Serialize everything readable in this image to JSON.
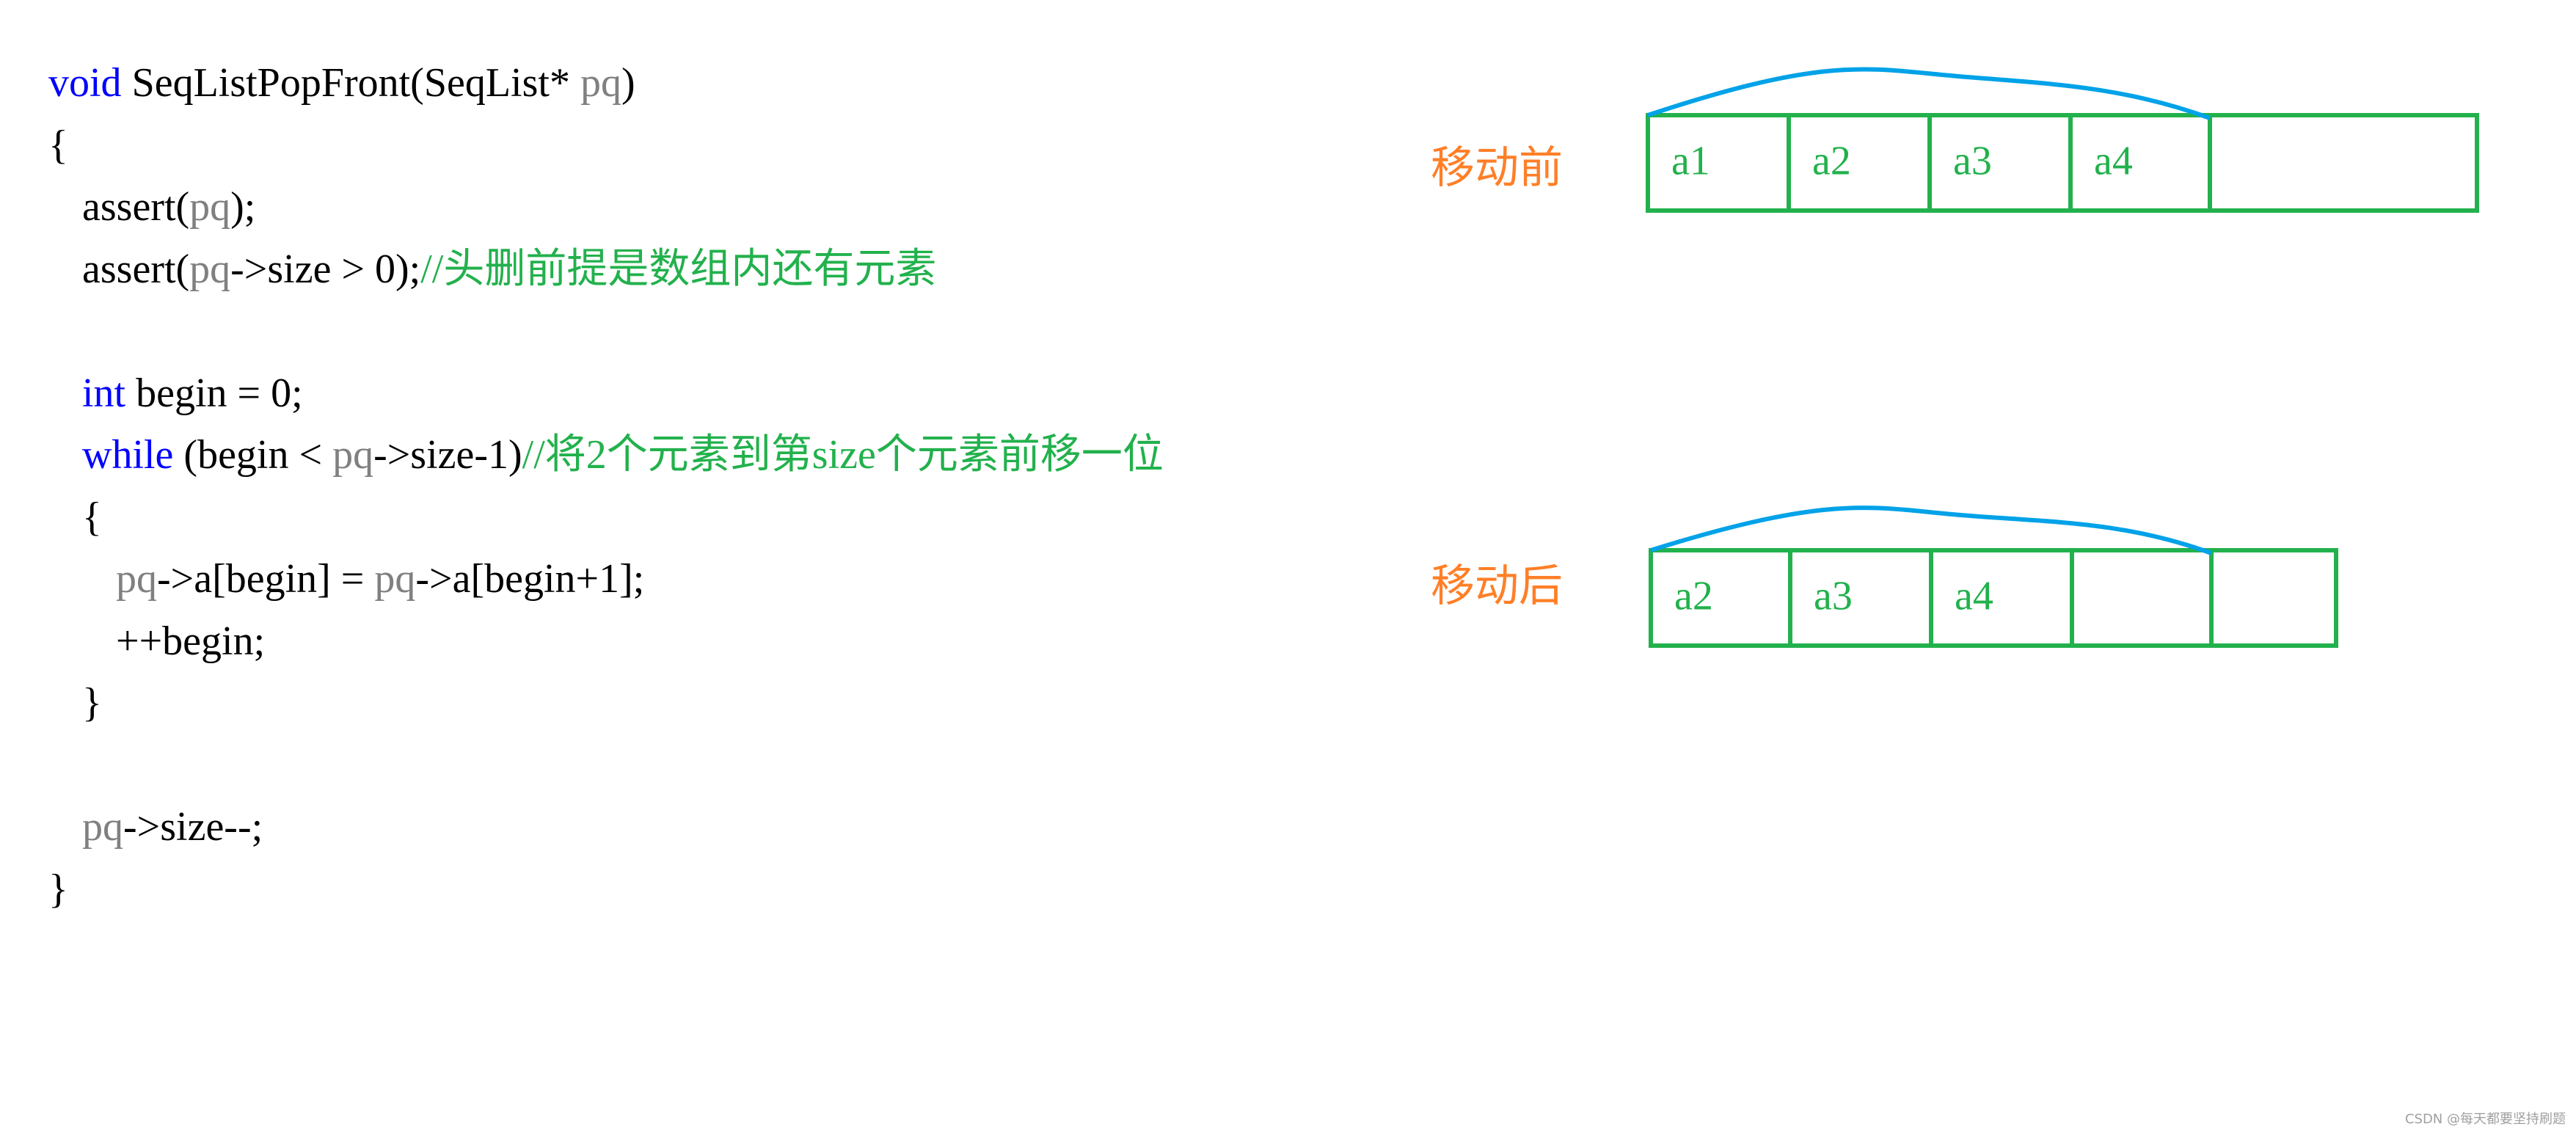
{
  "code": {
    "lines": [
      {
        "indent": 0,
        "parts": [
          {
            "t": "void",
            "c": "kw"
          },
          {
            "t": " SeqListPopFront(SeqList* ",
            "c": ""
          },
          {
            "t": "pq",
            "c": "var"
          },
          {
            "t": ")",
            "c": ""
          }
        ]
      },
      {
        "indent": 0,
        "parts": [
          {
            "t": "{",
            "c": ""
          }
        ]
      },
      {
        "indent": 1,
        "parts": [
          {
            "t": "assert(",
            "c": ""
          },
          {
            "t": "pq",
            "c": "var"
          },
          {
            "t": ");",
            "c": ""
          }
        ]
      },
      {
        "indent": 1,
        "parts": [
          {
            "t": "assert(",
            "c": ""
          },
          {
            "t": "pq",
            "c": "var"
          },
          {
            "t": "->size > 0);",
            "c": ""
          },
          {
            "t": "//头删前提是数组内还有元素",
            "c": "cm"
          }
        ]
      },
      {
        "indent": 0,
        "parts": []
      },
      {
        "indent": 1,
        "parts": [
          {
            "t": "int",
            "c": "kw"
          },
          {
            "t": " begin = 0;",
            "c": ""
          }
        ]
      },
      {
        "indent": 1,
        "parts": [
          {
            "t": "while",
            "c": "kw"
          },
          {
            "t": " (begin < ",
            "c": ""
          },
          {
            "t": "pq",
            "c": "var"
          },
          {
            "t": "->size-1)",
            "c": ""
          },
          {
            "t": "//将2个元素到第size个元素前移一位",
            "c": "cm"
          }
        ]
      },
      {
        "indent": 1,
        "parts": [
          {
            "t": "{",
            "c": ""
          }
        ]
      },
      {
        "indent": 2,
        "parts": [
          {
            "t": "pq",
            "c": "var"
          },
          {
            "t": "->a[begin] = ",
            "c": ""
          },
          {
            "t": "pq",
            "c": "var"
          },
          {
            "t": "->a[begin+1];",
            "c": ""
          }
        ]
      },
      {
        "indent": 2,
        "parts": [
          {
            "t": "++begin;",
            "c": ""
          }
        ]
      },
      {
        "indent": 1,
        "parts": [
          {
            "t": "}",
            "c": ""
          }
        ]
      },
      {
        "indent": 0,
        "parts": []
      },
      {
        "indent": 1,
        "parts": [
          {
            "t": "pq",
            "c": "var"
          },
          {
            "t": "->size--;",
            "c": ""
          }
        ]
      },
      {
        "indent": 0,
        "parts": [
          {
            "t": "}",
            "c": ""
          }
        ]
      }
    ]
  },
  "diagrams": {
    "before": {
      "label": "移动前",
      "cells": [
        "a1",
        "a2",
        "a3",
        "a4",
        ""
      ],
      "arc_spans_cells": 4
    },
    "after": {
      "label": "移动后",
      "cells": [
        "a2",
        "a3",
        "a4",
        "",
        ""
      ],
      "arc_spans_cells": 4
    }
  },
  "colors": {
    "keyword": "#0000ff",
    "variable": "#808080",
    "comment": "#22b14c",
    "label": "#ff7f27",
    "cell_border": "#22b14c",
    "arc": "#00a2e8"
  },
  "watermark": "CSDN @每天都要坚持刷题"
}
